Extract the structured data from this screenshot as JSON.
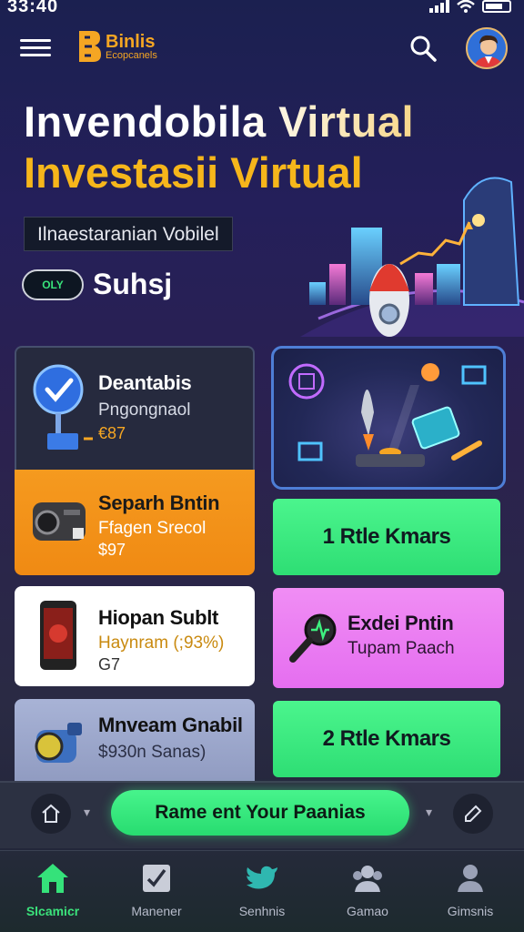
{
  "status_bar": {
    "time": "33:40"
  },
  "app_bar": {
    "logo_name": "Binlis",
    "logo_sub": "Ecopcanels"
  },
  "hero": {
    "title_line1": "Invendobila Virtual",
    "title_line2": "Investasii Virtual",
    "subtitle": "Ilnaestaranian Vobilel",
    "toggle_text": "OLY",
    "toggle_label": "Suhsj"
  },
  "cards_left": [
    {
      "title": "Deantabis",
      "line": "Pngonɡnaol",
      "price": "€87"
    },
    {
      "title": "Separh Bntin",
      "line": "Ffagen Srecol",
      "price": "$97"
    },
    {
      "title": "Hiopan Sublt",
      "line": "Haynram (;93%)",
      "price": "G7"
    },
    {
      "title": "Mnveam Gnabil",
      "line": "$930n Sanas)"
    }
  ],
  "cards_right": {
    "green1": "1 Rtle Kmars",
    "pink_title": "Exdei Pntin",
    "pink_line": "Tupam Paach",
    "green2": "2 Rtle Kmars"
  },
  "action_bar": {
    "cta_label": "Rame ent Your Paanias"
  },
  "bottom_nav": [
    {
      "label": "Slcamicr",
      "icon": "home-icon"
    },
    {
      "label": "Manener",
      "icon": "checklist-icon"
    },
    {
      "label": "Senhnis",
      "icon": "bird-icon"
    },
    {
      "label": "Gamao",
      "icon": "group-icon"
    },
    {
      "label": "Gimsnis",
      "icon": "profile-icon"
    }
  ],
  "colors": {
    "accent_green": "#2ede74",
    "accent_orange": "#f08a13",
    "accent_gold": "#f6b61b",
    "accent_pink": "#e56ef0"
  }
}
